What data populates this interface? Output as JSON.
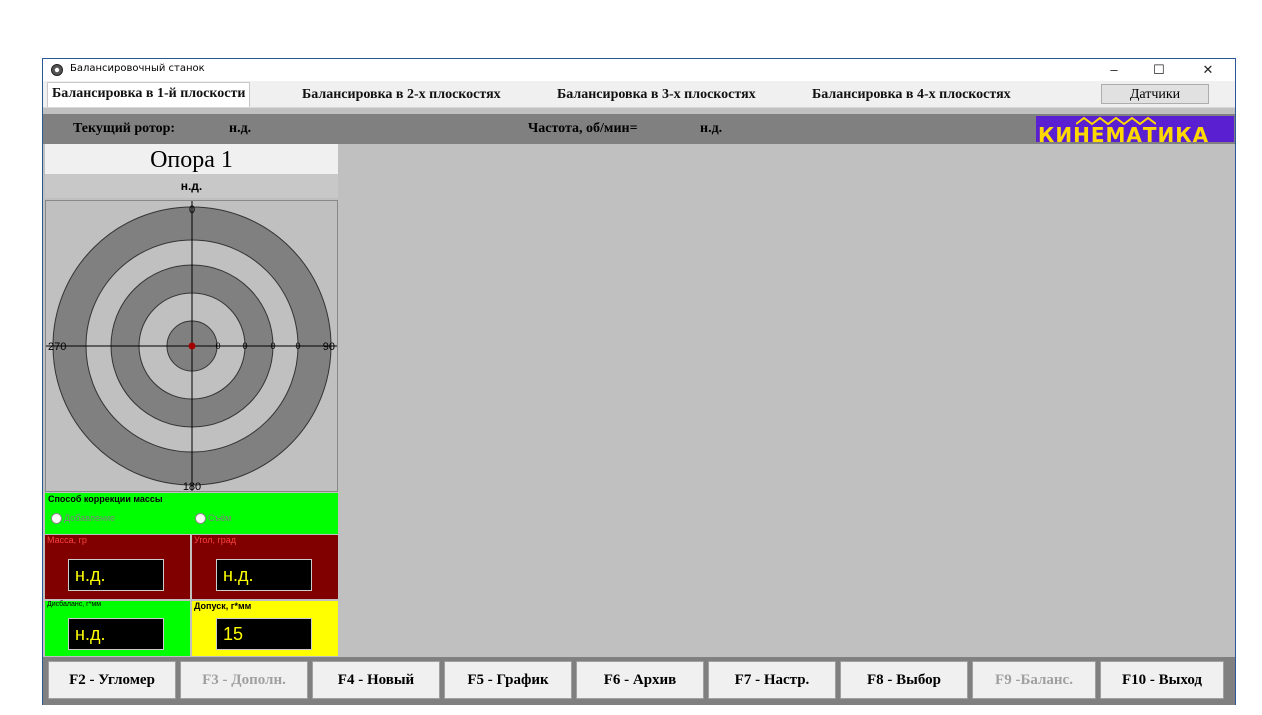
{
  "window": {
    "title": "Балансировочный станок",
    "minimize": "–",
    "maximize": "☐",
    "close": "✕"
  },
  "tabs": [
    {
      "label": "Балансировка в 1-й плоскости",
      "active": true
    },
    {
      "label": "Балансировка в 2-х плоскостях",
      "active": false
    },
    {
      "label": "Балансировка в 3-х плоскостях",
      "active": false
    },
    {
      "label": "Балансировка в 4-х плоскостях",
      "active": false
    }
  ],
  "sensors_button": "Датчики",
  "infobar": {
    "rotor_label": "Текущий ротор:",
    "rotor_value": "н.д.",
    "freq_label": "Частота, об/мин=",
    "freq_value": "н.д."
  },
  "logo_text": "КИНЕМАТИКА",
  "support": {
    "title": "Опора 1",
    "value": "н.д."
  },
  "target": {
    "angle_top": "0",
    "angle_right": "90",
    "angle_bottom": "180",
    "angle_left": "270",
    "scale_labels": [
      "0",
      "0",
      "0",
      "0"
    ]
  },
  "correction": {
    "label": "Способ коррекции массы",
    "option_add": "Добавление",
    "option_remove": "Съём"
  },
  "mass": {
    "label": "Масса, гр",
    "value": "н.д."
  },
  "angle": {
    "label": "Угол, град",
    "value": "н.д."
  },
  "imbalance": {
    "label": "Дисбаланс, г*мм",
    "value": "н.д."
  },
  "tolerance": {
    "label": "Допуск, г*мм",
    "value": "15"
  },
  "fkeys": [
    {
      "label": "F2 - Угломер",
      "enabled": true
    },
    {
      "label": "F3 - Дополн.",
      "enabled": false
    },
    {
      "label": "F4 - Новый",
      "enabled": true
    },
    {
      "label": "F5 - График",
      "enabled": true
    },
    {
      "label": "F6 - Архив",
      "enabled": true
    },
    {
      "label": "F7 - Настр.",
      "enabled": true
    },
    {
      "label": "F8 - Выбор",
      "enabled": true
    },
    {
      "label": "F9 -Баланс.",
      "enabled": false
    },
    {
      "label": "F10 - Выход",
      "enabled": true
    }
  ],
  "colors": {
    "accent_green": "#00ff00",
    "dark_red": "#800000",
    "tolerance_yellow": "#ffff00",
    "value_text": "#ffff00",
    "target_ring": "#808080",
    "center_dot": "#a00000"
  }
}
